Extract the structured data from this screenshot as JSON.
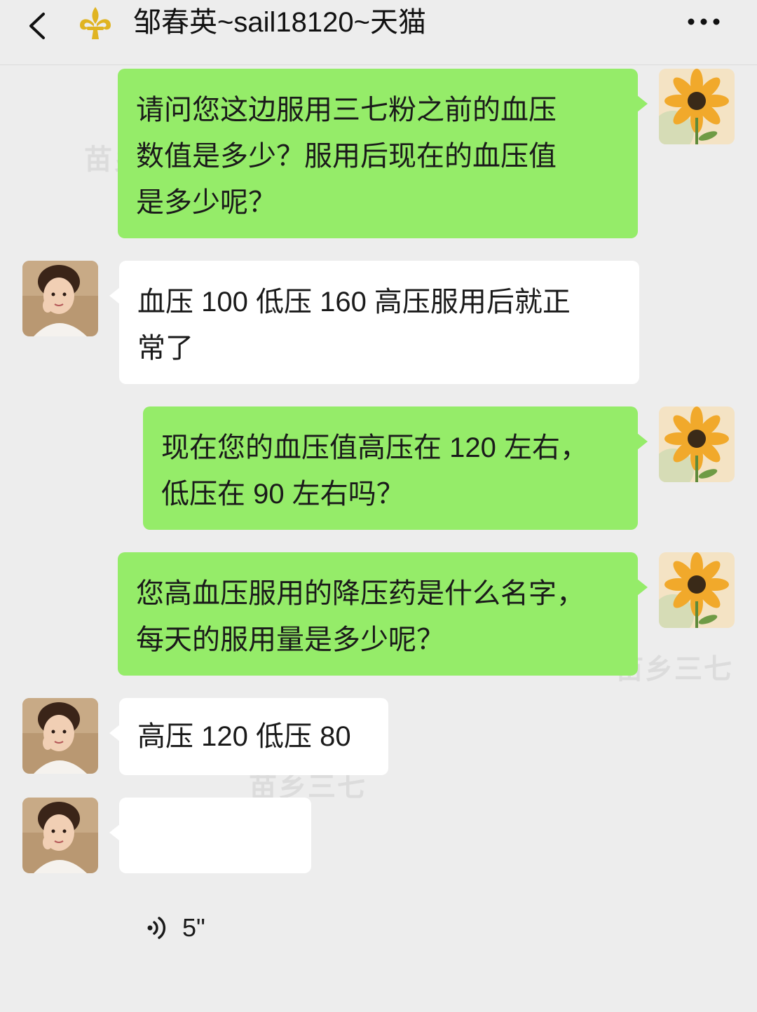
{
  "header": {
    "title": "邹春英~sail18120~天猫",
    "back_icon": "chevron-left-icon",
    "logo_icon": "fleur-de-lis-icon",
    "more_icon": "more-dots-icon"
  },
  "messages": [
    {
      "from": "self",
      "type": "text",
      "text": "请问您这边服用三七粉之前的血压\n数值是多少？服用后现在的血压值\n是多少呢？"
    },
    {
      "from": "other",
      "type": "text",
      "text": "血压 100 低压 160 高压服用后就正\n常了"
    },
    {
      "from": "self",
      "type": "text",
      "text": "现在您的血压值高压在 120 左右，\n低压在 90 左右吗？"
    },
    {
      "from": "self",
      "type": "text",
      "text": "您高血压服用的降压药是什么名字，\n每天的服用量是多少呢？"
    },
    {
      "from": "other",
      "type": "text",
      "text": "高压 120 低压 80"
    },
    {
      "from": "other",
      "type": "voice",
      "duration": "5\""
    }
  ],
  "watermark": "苗乡三七",
  "colors": {
    "background": "#ededed",
    "outgoing_bubble": "#95ec69",
    "incoming_bubble": "#ffffff"
  }
}
